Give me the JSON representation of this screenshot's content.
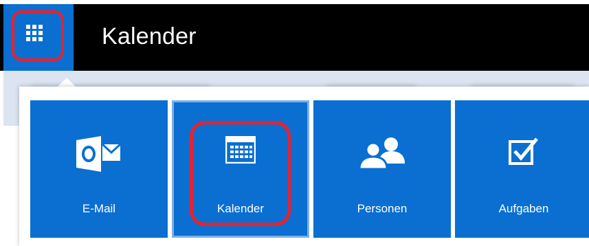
{
  "header": {
    "app_title": "Kalender",
    "launcher_icon": "waffle-icon"
  },
  "tiles": [
    {
      "label": "E-Mail",
      "icon": "outlook-mail-icon"
    },
    {
      "label": "Kalender",
      "icon": "calendar-icon",
      "selected": true
    },
    {
      "label": "Personen",
      "icon": "people-icon"
    },
    {
      "label": "Aufgaben",
      "icon": "checkbox-task-icon"
    }
  ],
  "colors": {
    "brand_blue": "#0a6fd1",
    "topbar": "#000000",
    "highlight_red": "#e8212e"
  }
}
